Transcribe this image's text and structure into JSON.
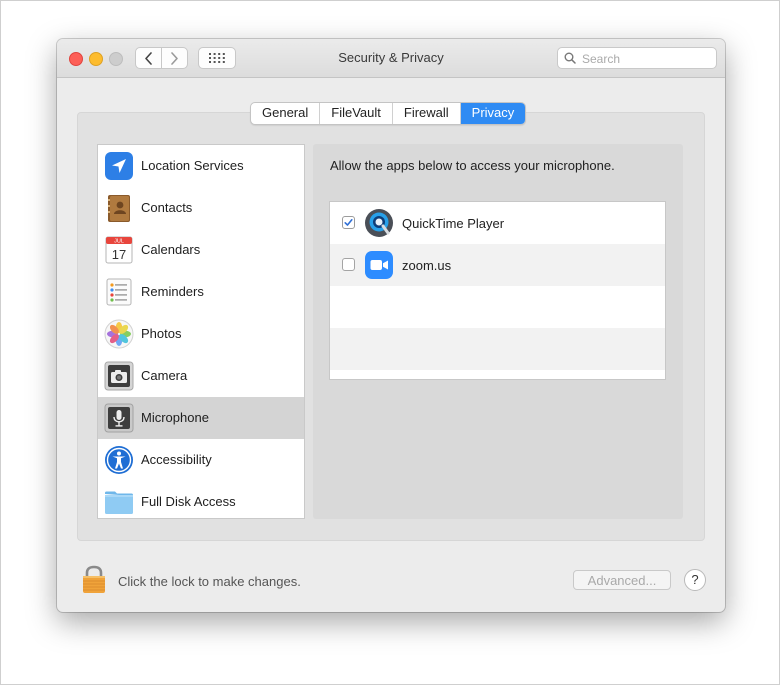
{
  "window": {
    "title": "Security & Privacy",
    "search_placeholder": "Search"
  },
  "tabs": [
    {
      "label": "General",
      "active": false
    },
    {
      "label": "FileVault",
      "active": false
    },
    {
      "label": "Firewall",
      "active": false
    },
    {
      "label": "Privacy",
      "active": true
    }
  ],
  "sidebar": {
    "items": [
      {
        "label": "Location Services",
        "icon": "location-arrow-icon",
        "selected": false
      },
      {
        "label": "Contacts",
        "icon": "contacts-book-icon",
        "selected": false
      },
      {
        "label": "Calendars",
        "icon": "calendar-icon",
        "selected": false,
        "icon_month": "JUL",
        "icon_day": "17"
      },
      {
        "label": "Reminders",
        "icon": "reminders-list-icon",
        "selected": false
      },
      {
        "label": "Photos",
        "icon": "photos-flower-icon",
        "selected": false
      },
      {
        "label": "Camera",
        "icon": "camera-icon",
        "selected": false
      },
      {
        "label": "Microphone",
        "icon": "microphone-icon",
        "selected": true
      },
      {
        "label": "Accessibility",
        "icon": "accessibility-icon",
        "selected": false
      },
      {
        "label": "Full Disk Access",
        "icon": "folder-icon",
        "selected": false
      }
    ]
  },
  "panel": {
    "description": "Allow the apps below to access your microphone.",
    "apps": [
      {
        "name": "QuickTime Player",
        "icon": "quicktime-icon",
        "checked": true
      },
      {
        "name": "zoom.us",
        "icon": "zoom-icon",
        "checked": false
      }
    ]
  },
  "footer": {
    "lock_text": "Click the lock to make changes.",
    "advanced_label": "Advanced...",
    "help_label": "?"
  },
  "colors": {
    "accent": "#2f8bf3",
    "close": "#fd5f57",
    "minimize": "#fdbc2e",
    "zoom_blue": "#2d8cff"
  }
}
